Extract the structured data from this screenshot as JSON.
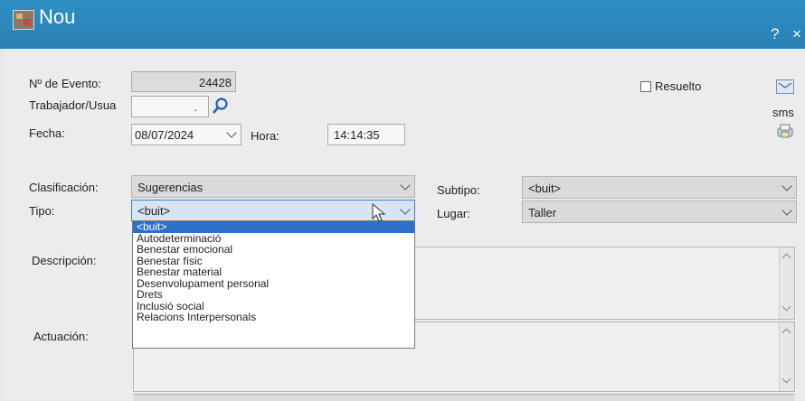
{
  "window": {
    "title": "Nou",
    "help_label": "?",
    "close_label": "×"
  },
  "form": {
    "evento_label": "Nº de Evento:",
    "evento_value": "24428",
    "trabajador_label": "Trabajador/Usua",
    "trabajador_dot": ".",
    "fecha_label": "Fecha:",
    "fecha_value": "08/07/2024",
    "hora_label": "Hora:",
    "hora_value": "14:14:35",
    "resuelto_label": "Resuelto",
    "clasificacion_label": "Clasificación:",
    "clasificacion_value": "Sugerencias",
    "tipo_label": "Tipo:",
    "tipo_value": "<buit>",
    "subtipo_label": "Subtipo:",
    "subtipo_value": "<buit>",
    "lugar_label": "Lugar:",
    "lugar_value": "Taller",
    "descripcion_label": "Descripción:",
    "actuacion_label": "Actuación:"
  },
  "side": {
    "sms_label": "sms"
  },
  "tipo_dropdown": {
    "options": [
      "<buit>",
      "Autodeterminació",
      "Benestar emocional",
      "Benestar físic",
      "Benestar material",
      "Desenvolupament personal",
      "Drets",
      "Inclusió social",
      "Relacions Interpersonals"
    ],
    "selected_index": 0
  },
  "colors": {
    "titlebar": "#2f8fc4",
    "selection": "#2f6fc9"
  }
}
